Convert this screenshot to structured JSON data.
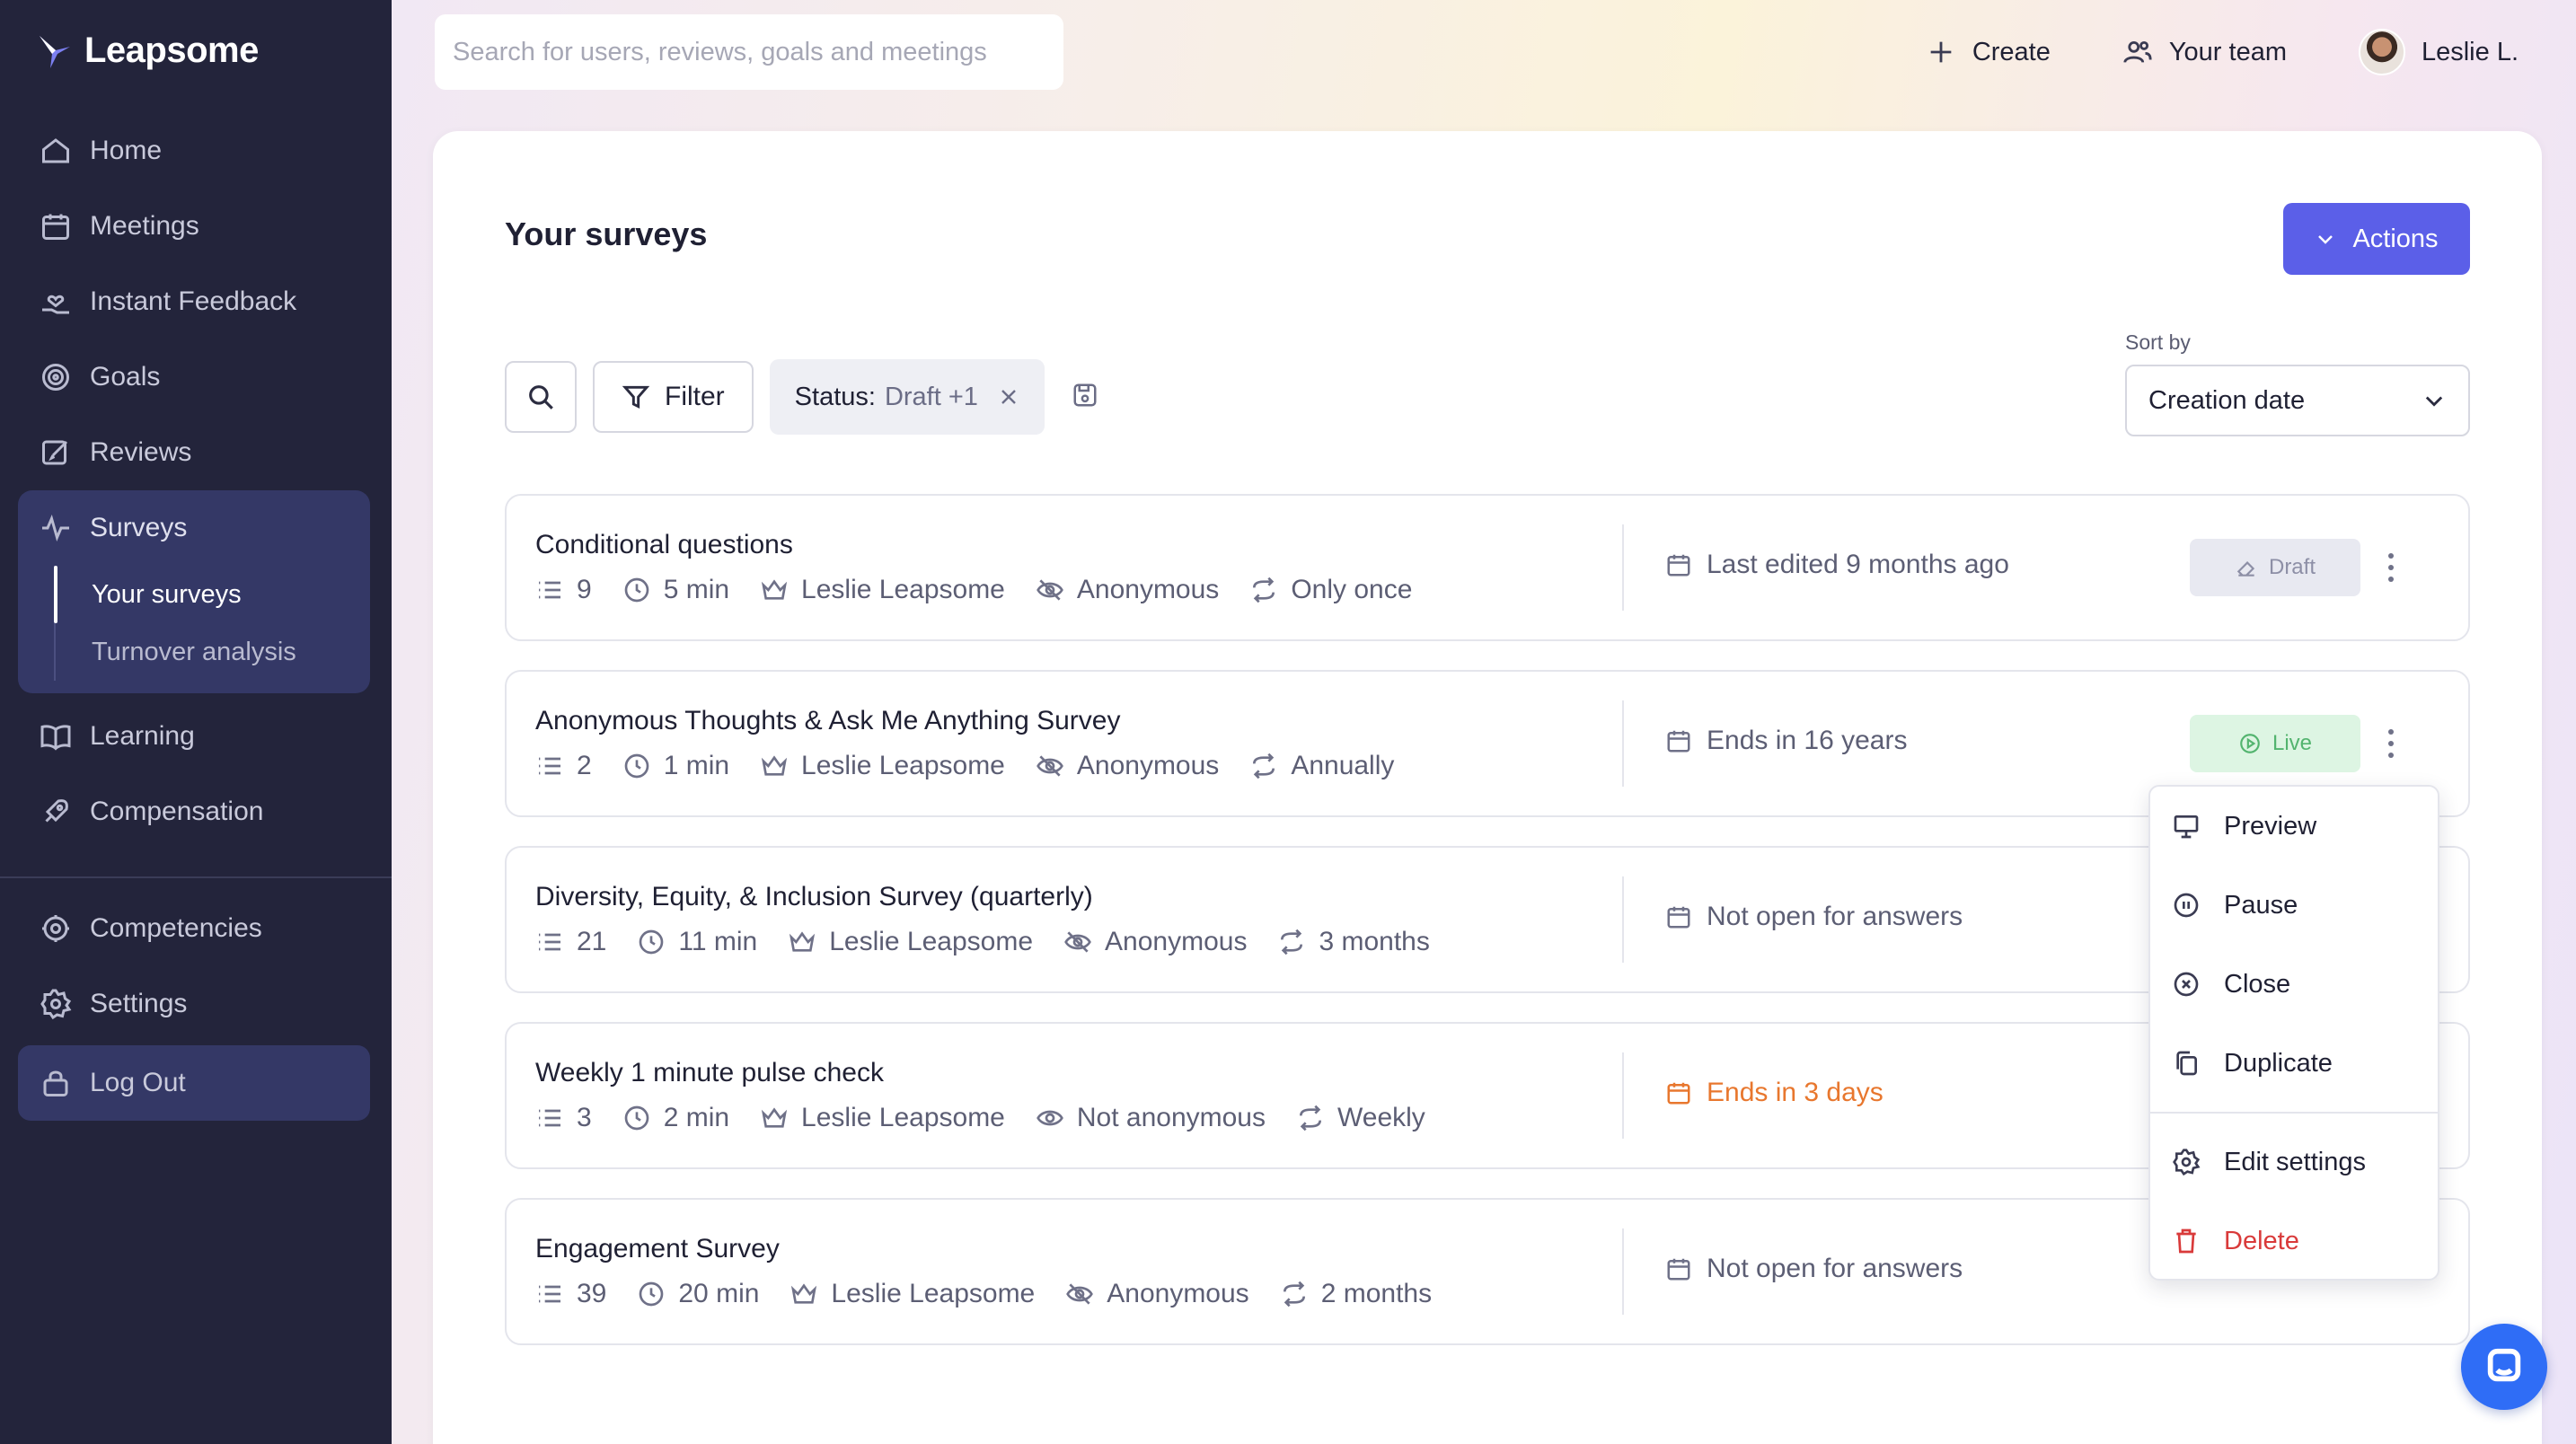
{
  "app": {
    "name": "Leapsome"
  },
  "sidebar": {
    "items": [
      {
        "label": "Home",
        "icon": "home-icon"
      },
      {
        "label": "Meetings",
        "icon": "calendar-icon"
      },
      {
        "label": "Instant Feedback",
        "icon": "hand-heart-icon"
      },
      {
        "label": "Goals",
        "icon": "target-icon"
      },
      {
        "label": "Reviews",
        "icon": "edit-icon"
      },
      {
        "label": "Surveys",
        "icon": "pulse-icon"
      },
      {
        "label": "Learning",
        "icon": "book-icon"
      },
      {
        "label": "Compensation",
        "icon": "rocket-icon"
      },
      {
        "label": "Competencies",
        "icon": "badge-icon"
      },
      {
        "label": "Settings",
        "icon": "gear-icon"
      },
      {
        "label": "Log Out",
        "icon": "lock-icon"
      }
    ],
    "surveys_sub": [
      {
        "label": "Your surveys",
        "active": true
      },
      {
        "label": "Turnover analysis",
        "active": false
      }
    ]
  },
  "header": {
    "search_placeholder": "Search for users, reviews, goals and meetings",
    "create_label": "Create",
    "team_label": "Your team",
    "user_name": "Leslie L."
  },
  "main": {
    "title": "Your surveys",
    "actions_label": "Actions",
    "filter_label": "Filter",
    "chip_key": "Status:",
    "chip_value": "Draft +1",
    "sort_label": "Sort by",
    "sort_value": "Creation date"
  },
  "surveys": [
    {
      "title": "Conditional questions",
      "questions": "9",
      "duration": "5 min",
      "owner": "Leslie Leapsome",
      "privacy": "Anonymous",
      "recurrence": "Only once",
      "status_text": "Last edited 9 months ago",
      "badge": "Draft"
    },
    {
      "title": "Anonymous Thoughts & Ask Me Anything Survey",
      "questions": "2",
      "duration": "1 min",
      "owner": "Leslie Leapsome",
      "privacy": "Anonymous",
      "recurrence": "Annually",
      "status_text": "Ends in 16 years",
      "badge": "Live"
    },
    {
      "title": "Diversity, Equity, & Inclusion Survey (quarterly)",
      "questions": "21",
      "duration": "11 min",
      "owner": "Leslie Leapsome",
      "privacy": "Anonymous",
      "recurrence": "3 months",
      "status_text": "Not open for answers",
      "badge": ""
    },
    {
      "title": "Weekly 1 minute pulse check",
      "questions": "3",
      "duration": "2 min",
      "owner": "Leslie Leapsome",
      "privacy": "Not anonymous",
      "recurrence": "Weekly",
      "status_text": "Ends in 3 days",
      "badge": ""
    },
    {
      "title": "Engagement Survey",
      "questions": "39",
      "duration": "20 min",
      "owner": "Leslie Leapsome",
      "privacy": "Anonymous",
      "recurrence": "2 months",
      "status_text": "Not open for answers",
      "badge": ""
    }
  ],
  "menu": {
    "items": [
      {
        "label": "Preview",
        "icon": "presentation-icon"
      },
      {
        "label": "Pause",
        "icon": "pause-icon"
      },
      {
        "label": "Close",
        "icon": "close-circle-icon"
      },
      {
        "label": "Duplicate",
        "icon": "duplicate-icon"
      },
      {
        "label": "Edit settings",
        "icon": "gear-icon"
      },
      {
        "label": "Delete",
        "icon": "trash-icon"
      }
    ]
  },
  "colors": {
    "sidebar_bg": "#23243b",
    "accent": "#5b5fe8",
    "warning": "#e8772e",
    "live": "#53b46f",
    "danger": "#d93a3a"
  }
}
